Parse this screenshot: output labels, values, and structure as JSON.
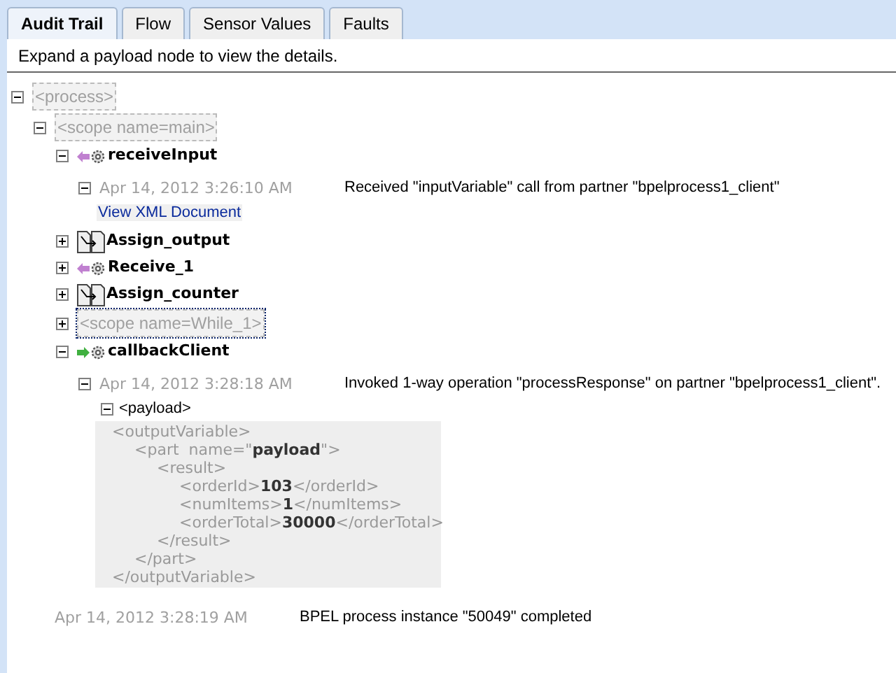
{
  "tabs": [
    {
      "label": "Audit Trail",
      "selected": true
    },
    {
      "label": "Flow",
      "selected": false
    },
    {
      "label": "Sensor Values",
      "selected": false
    },
    {
      "label": "Faults",
      "selected": false
    }
  ],
  "hint": "Expand a payload node to view the details.",
  "tree": [
    {
      "kind": "scope",
      "label": "<process>",
      "expanded": true,
      "selected": false,
      "children": [
        {
          "kind": "scope",
          "label": "<scope name=main>",
          "expanded": true,
          "selected": false,
          "children": [
            {
              "kind": "receive",
              "label": "receiveInput",
              "expanded": true,
              "selected": false,
              "events": [
                {
                  "time": "Apr 14, 2012 3:26:10 AM",
                  "message": "Received \"inputVariable\" call from partner \"bpelprocess1_client\"",
                  "expanded": true,
                  "link": "View XML Document"
                }
              ]
            },
            {
              "kind": "assign",
              "label": "Assign_output",
              "expanded": false,
              "selected": false
            },
            {
              "kind": "receive",
              "label": "Receive_1",
              "expanded": false,
              "selected": false
            },
            {
              "kind": "assign",
              "label": "Assign_counter",
              "expanded": false,
              "selected": false
            },
            {
              "kind": "scope",
              "label": "<scope name=While_1>",
              "expanded": false,
              "selected": true
            },
            {
              "kind": "invoke",
              "label": "callbackClient",
              "expanded": true,
              "selected": false,
              "events": [
                {
                  "time": "Apr 14, 2012 3:28:18 AM",
                  "message": "Invoked 1-way operation \"processResponse\" on partner \"bpelprocess1_client\".",
                  "expanded": true,
                  "payload": {
                    "label": "<payload>",
                    "expanded": true,
                    "xml": [
                      {
                        "open": "<outputVariable>",
                        "close": "</outputVariable>",
                        "children": [
                          {
                            "open": "<part  name=\"**payload**\">",
                            "close": "</part>",
                            "children": [
                              {
                                "open": "<result>",
                                "close": "</result>",
                                "children": [
                                  {
                                    "text": "<orderId>**103**</orderId>"
                                  },
                                  {
                                    "text": "<numItems>**1**</numItems>"
                                  },
                                  {
                                    "text": "<orderTotal>**30000**</orderTotal>"
                                  }
                                ]
                              }
                            ]
                          }
                        ]
                      }
                    ]
                  }
                }
              ]
            }
          ]
        }
      ],
      "events": [
        {
          "time": "Apr 14, 2012 3:28:19 AM",
          "message": "BPEL process instance \"50049\" completed"
        }
      ]
    }
  ]
}
